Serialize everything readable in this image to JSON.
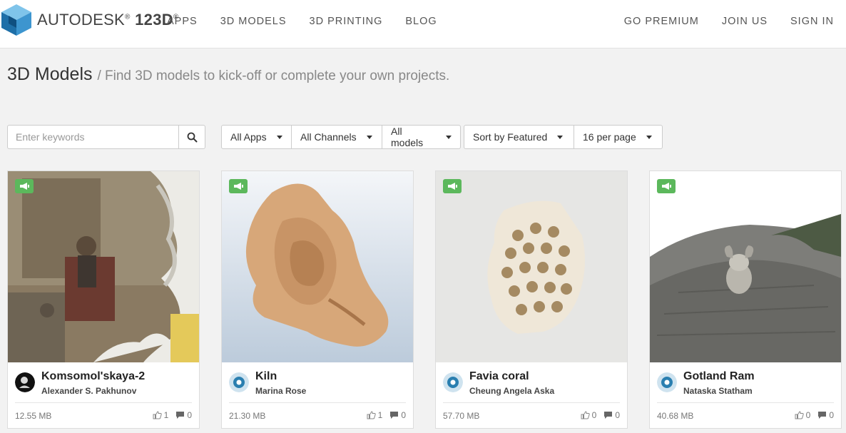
{
  "brand": {
    "name": "AUTODESK",
    "product": "123D",
    "reg": "®"
  },
  "nav": {
    "left": [
      "APPS",
      "3D MODELS",
      "3D PRINTING",
      "BLOG"
    ],
    "right": [
      "GO PREMIUM",
      "JOIN US",
      "SIGN IN"
    ]
  },
  "page": {
    "title": "3D Models",
    "subtitle": "/ Find 3D models to kick-off or complete your own projects."
  },
  "search": {
    "placeholder": "Enter keywords"
  },
  "filters": {
    "apps": "All Apps",
    "channels": "All Channels",
    "models": "All models",
    "sort": "Sort by Featured",
    "per_page": "16 per page"
  },
  "colors": {
    "badge": "#5cb85c",
    "brand_blue": "#1e6fa8"
  },
  "cards": [
    {
      "name": "Komsomol'skaya-2",
      "author": "Alexander S. Pakhunov",
      "size": "12.55 MB",
      "likes": "1",
      "comments": "0",
      "badge_icon": "megaphone-icon"
    },
    {
      "name": "Kiln",
      "author": "Marina Rose",
      "size": "21.30 MB",
      "likes": "1",
      "comments": "0",
      "badge_icon": "megaphone-icon"
    },
    {
      "name": "Favia coral",
      "author": "Cheung Angela Aska",
      "size": "57.70 MB",
      "likes": "0",
      "comments": "0",
      "badge_icon": "megaphone-icon"
    },
    {
      "name": "Gotland Ram",
      "author": "Nataska Statham",
      "size": "40.68 MB",
      "likes": "0",
      "comments": "0",
      "badge_icon": "megaphone-icon"
    }
  ]
}
